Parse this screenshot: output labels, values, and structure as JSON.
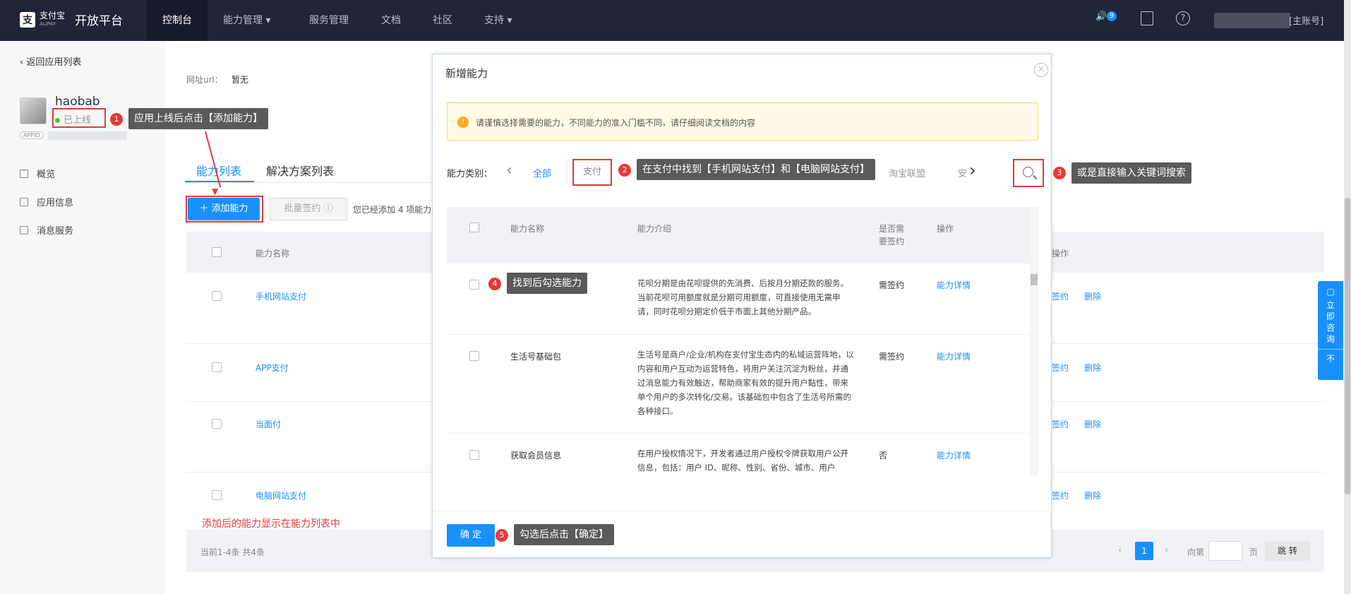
{
  "topnav": {
    "logo_cn": "支付宝",
    "logo_en": "ALIPAY",
    "title": "开放平台",
    "items": [
      "控制台",
      "能力管理 ▾",
      "服务管理",
      "文档",
      "社区",
      "支持 ▾"
    ],
    "notif_count": "9",
    "account": "[主账号]"
  },
  "sidebar": {
    "back": "返回应用列表",
    "app_name": "haobab",
    "status": "已上线",
    "appid_tag": "APPID",
    "items": [
      "概览",
      "应用信息",
      "消息服务"
    ]
  },
  "main": {
    "url_label": "网址url：",
    "url_value": "暂无",
    "tabs": [
      "能力列表",
      "解决方案列表"
    ],
    "add_button": "＋ 添加能力",
    "batch_button": "批量签约",
    "added_text": "您已经添加 4 项能力",
    "col_name": "能力名称",
    "col_op": "操作",
    "rows": [
      "手机网站支付",
      "APP支付",
      "当面付",
      "电脑网站支付"
    ],
    "op_sign": "签约",
    "op_delete": "删除",
    "footer_count": "当前1-4条 共4条",
    "page_current": "1",
    "page_goto": "向第",
    "page_unit": "页",
    "page_jump": "跳 转"
  },
  "modal": {
    "title": "新增能力",
    "warning": "请谨慎选择需要的能力，不同能力的准入门槛不同，请仔细阅读文档的内容",
    "category_label": "能力类别：",
    "categories": [
      "全部",
      "支付",
      "淘宝联盟",
      "安"
    ],
    "col_name": "能力名称",
    "col_desc": "能力介绍",
    "col_sign": "是否需要签约",
    "col_op": "操作",
    "rows": [
      {
        "name": "",
        "desc": "花呗分期是由花呗提供的先消费、后按月分期还款的服务。当前花呗可用额度就是分期可用额度，可直接使用无需申请，同时花呗分期定价低于市面上其他分期产品。",
        "sign": "需签约",
        "op": "能力详情"
      },
      {
        "name": "生活号基础包",
        "desc": "生活号是商户/企业/机构在支付宝生态内的私域运营阵地，以内容和用户互动为运营特色，将用户关注沉淀为粉丝，并通过消息能力有效触达，帮助商家有效的提升用户黏性，带来单个用户的多次转化/交易。该基础包中包含了生活号所需的各种接口。",
        "sign": "需签约",
        "op": "能力详情"
      },
      {
        "name": "获取会员信息",
        "desc": "在用户授权情况下，开发者通过用户授权令牌获取用户公开信息，包括：用户 ID、昵称、性别、省份、城市、用户",
        "sign": "否",
        "op": "能力详情"
      }
    ],
    "confirm": "确 定"
  },
  "annotations": {
    "a1": "应用上线后点击【添加能力】",
    "a2": "在支付中找到【手机网站支付】和【电脑网站支付】",
    "a3": "或是直接输入关键词搜索",
    "a4": "找到后勾选能力",
    "a5": "勾选后点击【确定】",
    "added_note": "添加后的能力显示在能力列表中",
    "nums": [
      "1",
      "2",
      "3",
      "4",
      "5"
    ]
  },
  "float_button": {
    "label": "立即咨询",
    "arrow": "不"
  }
}
